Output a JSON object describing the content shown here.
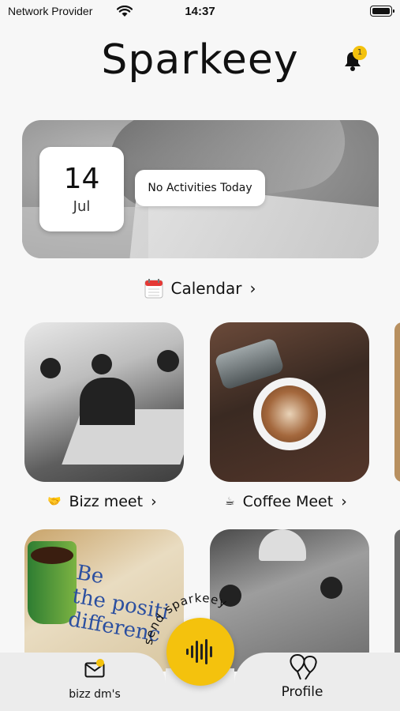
{
  "status_bar": {
    "carrier": "Network Provider",
    "time": "14:37"
  },
  "header": {
    "title": "Sparkeey",
    "notification_count": "1"
  },
  "hero": {
    "day": "14",
    "month": "Jul",
    "message": "No Activities Today"
  },
  "calendar_link": {
    "label": "Calendar",
    "chevron": "›"
  },
  "cards": [
    {
      "label": "Bizz meet",
      "chevron": "›",
      "icon": "handshake-icon"
    },
    {
      "label": "Coffee Meet",
      "chevron": "›",
      "icon": "coffee-icon"
    }
  ],
  "quote_card": {
    "line1": "Be",
    "line2": "the positi",
    "line3": "differenc"
  },
  "fab": {
    "curved_label": "send sparkeey"
  },
  "bottom_bar": {
    "left_label": "bizz dm's",
    "right_label": "Profile"
  },
  "colors": {
    "accent": "#f4c20d",
    "background": "#f7f7f7",
    "tab_bar": "#ececec"
  }
}
